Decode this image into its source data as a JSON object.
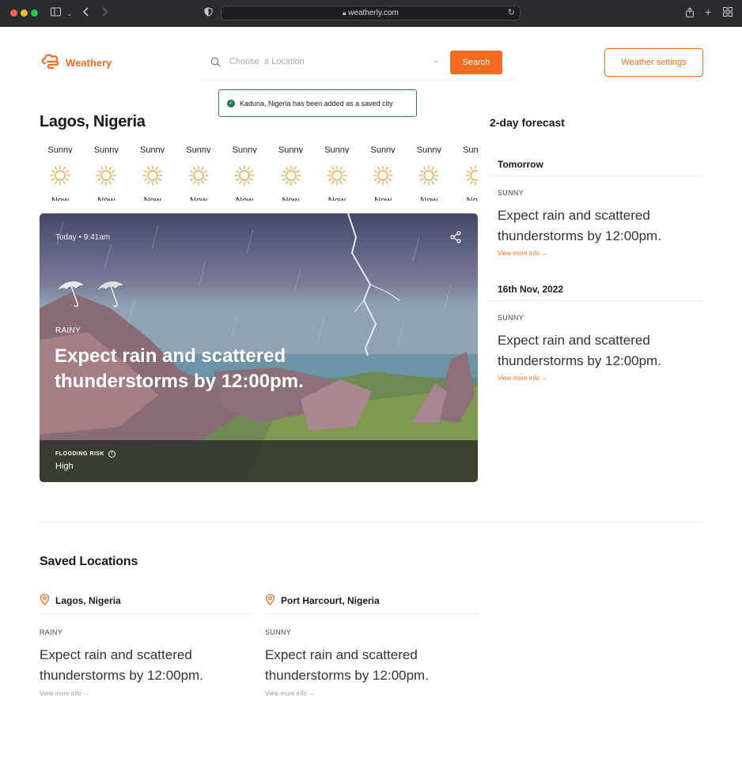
{
  "browser": {
    "url": "weatherly.com"
  },
  "header": {
    "brand": "Weathery",
    "search_placeholder": "Choose  a Location",
    "search_button": "Search",
    "settings_button": "Weather settings"
  },
  "toast": {
    "message": "Kaduna, Nigeria has been added as a saved city"
  },
  "city": {
    "name": "Lagos, Nigeria"
  },
  "hourly": [
    {
      "label": "Sunny",
      "day": "Now"
    },
    {
      "label": "Sunny",
      "day": "Now"
    },
    {
      "label": "Sunny",
      "day": "Now"
    },
    {
      "label": "Sunny",
      "day": "Now"
    },
    {
      "label": "Sunny",
      "day": "Now"
    },
    {
      "label": "Sunny",
      "day": "Now"
    },
    {
      "label": "Sunny",
      "day": "Now"
    },
    {
      "label": "Sunny",
      "day": "Now"
    },
    {
      "label": "Sunny",
      "day": "Now"
    },
    {
      "label": "Sunny",
      "day": "Now"
    }
  ],
  "hero": {
    "time": "Today • 9:41am",
    "condition": "RAINY",
    "headline": "Expect rain and scattered thunderstorms by 12:00pm.",
    "risk_label": "FLOODING RISK",
    "risk_value": "High"
  },
  "forecast": {
    "title": "2-day forecast",
    "days": [
      {
        "heading": "Tomorrow",
        "condition": "SUNNY",
        "text": "Expect rain and scattered thunderstorms by 12:00pm.",
        "link": "View more info →"
      },
      {
        "heading": "16th Nov, 2022",
        "condition": "SUNNY",
        "text": "Expect rain and scattered thunderstorms by 12:00pm.",
        "link": "View more info →"
      }
    ]
  },
  "saved": {
    "title": "Saved Locations",
    "items": [
      {
        "city": "Lagos, Nigeria",
        "condition": "RAINY",
        "text": "Expect rain and scattered thunderstorms by 12:00pm.",
        "link": "View more info →"
      },
      {
        "city": "Port Harcourt, Nigeria",
        "condition": "SUNNY",
        "text": "Expect rain and scattered thunderstorms by 12:00pm.",
        "link": "View more info →"
      }
    ]
  },
  "colors": {
    "brand": "#f26b21",
    "success": "#1f7a47"
  }
}
